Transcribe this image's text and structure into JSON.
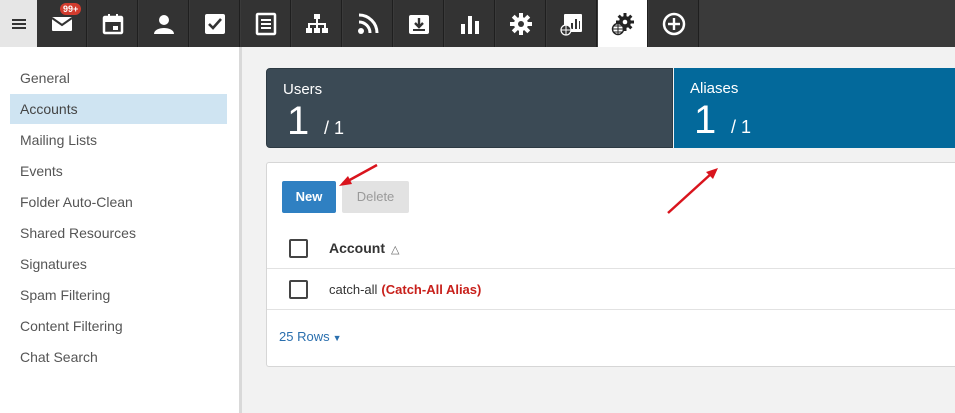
{
  "topbar": {
    "menu_icon": "hamburger-icon",
    "tabs": [
      {
        "icon": "mail-icon",
        "badge": "99+"
      },
      {
        "icon": "calendar-icon"
      },
      {
        "icon": "user-icon"
      },
      {
        "icon": "checkbox-icon"
      },
      {
        "icon": "notes-icon"
      },
      {
        "icon": "org-chart-icon"
      },
      {
        "icon": "rss-icon"
      },
      {
        "icon": "download-tray-icon"
      },
      {
        "icon": "bar-chart-icon"
      },
      {
        "icon": "gear-icon"
      },
      {
        "icon": "globe-report-icon"
      },
      {
        "icon": "globe-gear-icon",
        "active": true
      },
      {
        "icon": "plus-circle-icon"
      }
    ]
  },
  "sidebar": {
    "items": [
      {
        "label": "General"
      },
      {
        "label": "Accounts",
        "active": true
      },
      {
        "label": "Mailing Lists"
      },
      {
        "label": "Events"
      },
      {
        "label": "Folder Auto-Clean"
      },
      {
        "label": "Shared Resources"
      },
      {
        "label": "Signatures"
      },
      {
        "label": "Spam Filtering"
      },
      {
        "label": "Content Filtering"
      },
      {
        "label": "Chat Search"
      }
    ]
  },
  "stats": {
    "users": {
      "label": "Users",
      "count": "1",
      "total": "/ 1"
    },
    "aliases": {
      "label": "Aliases",
      "count": "1",
      "total": "/ 1"
    }
  },
  "toolbar": {
    "new_label": "New",
    "delete_label": "Delete"
  },
  "table": {
    "column_header": "Account",
    "rows": [
      {
        "account": "catch-all",
        "tag": "(Catch-All Alias)"
      }
    ]
  },
  "pagination": {
    "rows_label": "25 Rows"
  },
  "colors": {
    "topbar": "#333333",
    "active_nav": "#cfe4f2",
    "users_stat": "#3b4a55",
    "aliases_stat": "#03699b",
    "primary_button": "#2f80c2",
    "alias_tag": "#c8201b",
    "annotation_arrow": "#d9141d"
  }
}
